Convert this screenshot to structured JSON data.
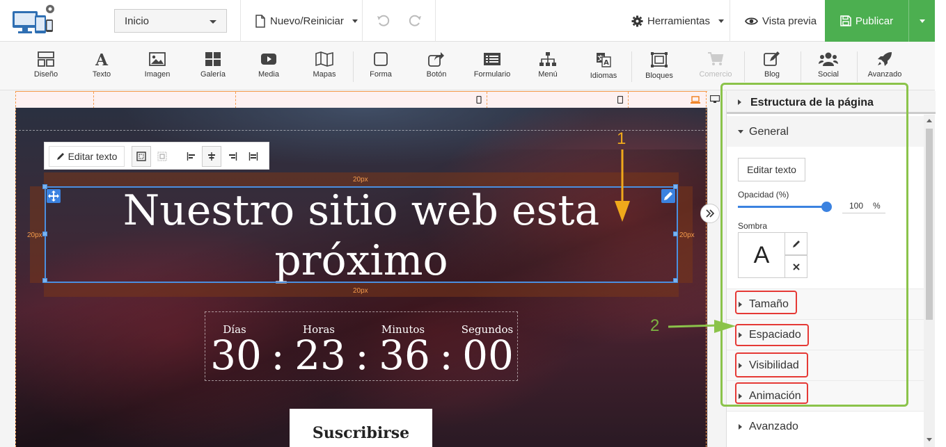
{
  "topbar": {
    "page_select": "Inicio",
    "new_reset": "Nuevo/Reiniciar",
    "tools": "Herramientas",
    "preview": "Vista previa",
    "publish": "Publicar"
  },
  "ribbon": [
    {
      "label": "Diseño",
      "icon": "layout-icon"
    },
    {
      "label": "Texto",
      "icon": "text-icon"
    },
    {
      "label": "Imagen",
      "icon": "image-icon"
    },
    {
      "label": "Galería",
      "icon": "gallery-icon"
    },
    {
      "label": "Media",
      "icon": "media-icon"
    },
    {
      "label": "Mapas",
      "icon": "map-icon"
    },
    {
      "label": "Forma",
      "icon": "shape-icon"
    },
    {
      "label": "Botón",
      "icon": "button-icon"
    },
    {
      "label": "Formulario",
      "icon": "form-icon"
    },
    {
      "label": "Menú",
      "icon": "menu-icon"
    },
    {
      "label": "Idiomas",
      "icon": "languages-icon"
    },
    {
      "label": "Bloques",
      "icon": "blocks-icon"
    },
    {
      "label": "Comercio",
      "icon": "cart-icon",
      "disabled": true
    },
    {
      "label": "Blog",
      "icon": "blog-icon"
    },
    {
      "label": "Social",
      "icon": "social-icon"
    },
    {
      "label": "Avanzado",
      "icon": "rocket-icon"
    }
  ],
  "canvas": {
    "edit_text": "Editar texto",
    "padding_label": "20px",
    "headline": "Nuestro sitio web esta próximo",
    "countdown": {
      "labels": [
        "Días",
        "Horas",
        "Minutos",
        "Segundos"
      ],
      "values": [
        "30",
        "23",
        "36",
        "00"
      ],
      "separator": ":"
    },
    "subscribe": "Suscribirse"
  },
  "panel": {
    "title": "Estructura de la página",
    "general": "General",
    "edit_text": "Editar texto",
    "opacity_label": "Opacidad (%)",
    "opacity_value": "100",
    "opacity_unit": "%",
    "opacity_fraction": 1.0,
    "shadow_label": "Sombra",
    "shadow_preview": "A",
    "sections": [
      "Tamaño",
      "Espaciado",
      "Visibilidad",
      "Animación",
      "Avanzado"
    ]
  },
  "annotations": {
    "one": "1",
    "two": "2"
  },
  "colors": {
    "publish_green": "#4caf50",
    "selection_blue": "#4a8fe0",
    "frame_green": "#8bc34a",
    "highlight_red": "#e53935",
    "arrow_orange": "#f0a91b",
    "guide_orange": "#f59b4c"
  }
}
